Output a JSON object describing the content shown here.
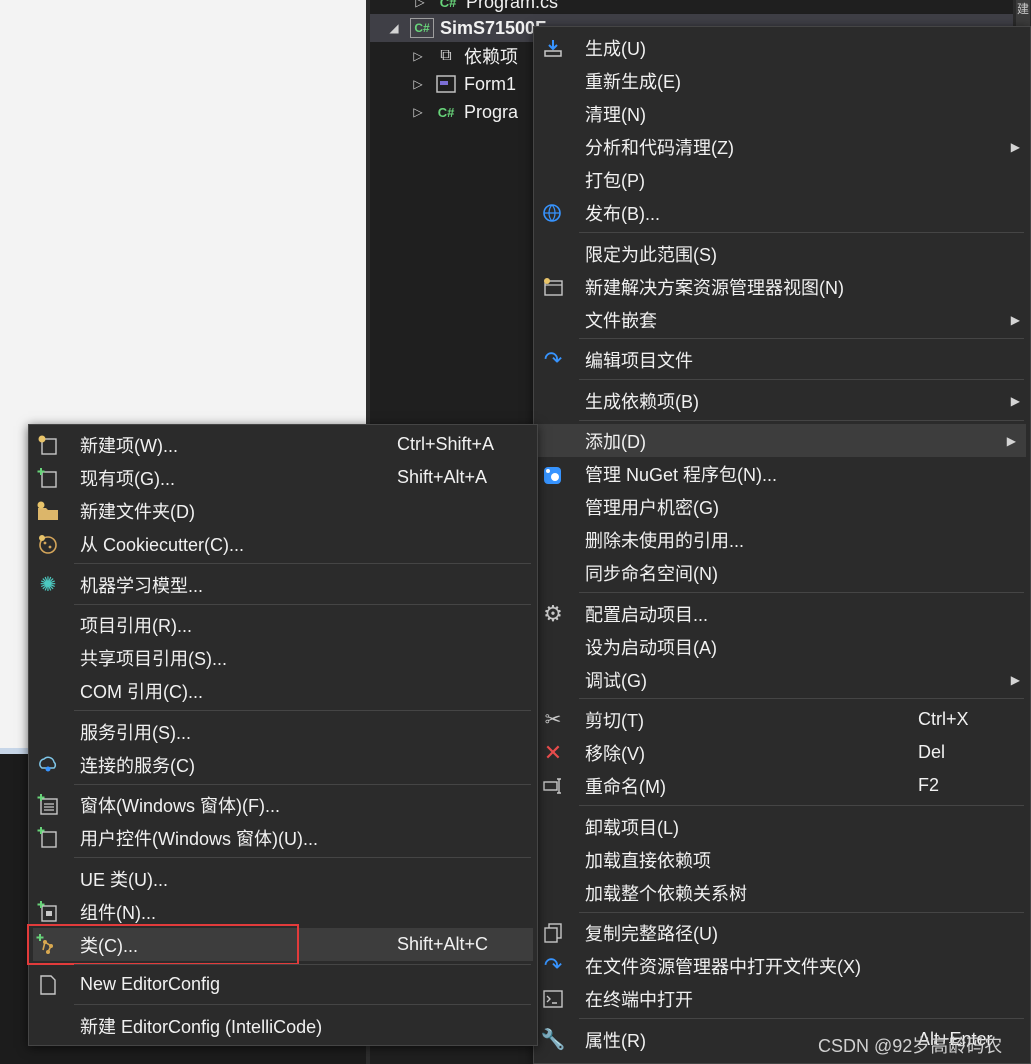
{
  "tree": {
    "rows": [
      {
        "label": "Program.cs",
        "icon": "csharp-file-icon"
      },
      {
        "label": "SimS71500F...",
        "icon": "csharp-project-icon"
      },
      {
        "label": "依赖项",
        "icon": "dependencies-icon"
      },
      {
        "label": "Form1",
        "icon": "form-icon"
      },
      {
        "label": "Progra",
        "icon": "csharp-file-icon"
      }
    ],
    "side_tab": "建"
  },
  "main_menu": {
    "items": [
      {
        "label": "生成(U)",
        "icon": "build-icon"
      },
      {
        "label": "重新生成(E)"
      },
      {
        "label": "清理(N)"
      },
      {
        "label": "分析和代码清理(Z)",
        "submenu": true
      },
      {
        "label": "打包(P)"
      },
      {
        "label": "发布(B)...",
        "icon": "globe-publish-icon"
      },
      {
        "label": "限定为此范围(S)"
      },
      {
        "label": "新建解决方案资源管理器视图(N)",
        "icon": "new-view-icon"
      },
      {
        "label": "文件嵌套",
        "submenu": true
      },
      {
        "label": "编辑项目文件",
        "icon": "edit-arrow-icon"
      },
      {
        "label": "生成依赖项(B)",
        "submenu": true
      },
      {
        "label": "添加(D)",
        "submenu": true
      },
      {
        "label": "管理 NuGet 程序包(N)...",
        "icon": "nuget-icon"
      },
      {
        "label": "管理用户机密(G)"
      },
      {
        "label": "删除未使用的引用..."
      },
      {
        "label": "同步命名空间(N)"
      },
      {
        "label": "配置启动项目...",
        "icon": "gear-icon"
      },
      {
        "label": "设为启动项目(A)"
      },
      {
        "label": "调试(G)",
        "submenu": true
      },
      {
        "label": "剪切(T)",
        "shortcut": "Ctrl+X",
        "icon": "scissors-icon"
      },
      {
        "label": "移除(V)",
        "shortcut": "Del",
        "icon": "remove-x-icon"
      },
      {
        "label": "重命名(M)",
        "shortcut": "F2",
        "icon": "rename-icon"
      },
      {
        "label": "卸载项目(L)"
      },
      {
        "label": "加载直接依赖项"
      },
      {
        "label": "加载整个依赖关系树"
      },
      {
        "label": "复制完整路径(U)",
        "icon": "copy-icon"
      },
      {
        "label": "在文件资源管理器中打开文件夹(X)",
        "icon": "open-folder-arrow-icon"
      },
      {
        "label": "在终端中打开",
        "icon": "terminal-icon"
      },
      {
        "label": "属性(R)",
        "shortcut": "Alt+Enter",
        "icon": "wrench-icon"
      }
    ]
  },
  "sub_menu": {
    "items": [
      {
        "label": "新建项(W)...",
        "shortcut": "Ctrl+Shift+A",
        "icon": "new-item-icon"
      },
      {
        "label": "现有项(G)...",
        "shortcut": "Shift+Alt+A",
        "icon": "existing-item-icon"
      },
      {
        "label": "新建文件夹(D)",
        "icon": "new-folder-icon"
      },
      {
        "label": "从 Cookiecutter(C)...",
        "icon": "cookiecutter-icon"
      },
      {
        "label": "机器学习模型...",
        "icon": "ml-model-icon"
      },
      {
        "label": "项目引用(R)..."
      },
      {
        "label": "共享项目引用(S)..."
      },
      {
        "label": "COM 引用(C)..."
      },
      {
        "label": "服务引用(S)..."
      },
      {
        "label": "连接的服务(C)",
        "icon": "connected-service-icon"
      },
      {
        "label": "窗体(Windows 窗体)(F)...",
        "icon": "form-add-icon"
      },
      {
        "label": "用户控件(Windows 窗体)(U)...",
        "icon": "user-control-add-icon"
      },
      {
        "label": "UE 类(U)..."
      },
      {
        "label": "组件(N)...",
        "icon": "component-add-icon"
      },
      {
        "label": "类(C)...",
        "shortcut": "Shift+Alt+C",
        "icon": "class-add-icon"
      },
      {
        "label": "New EditorConfig",
        "icon": "document-icon"
      },
      {
        "label": "新建 EditorConfig (IntelliCode)"
      }
    ]
  },
  "watermark": "CSDN @92岁高龄码农",
  "colors": {
    "menu_bg": "#2b2b2b",
    "hover_bg": "#3d3d3d",
    "highlight_border": "#e23b3b",
    "accent_blue": "#3794ff",
    "csharp_green": "#68d47a"
  }
}
